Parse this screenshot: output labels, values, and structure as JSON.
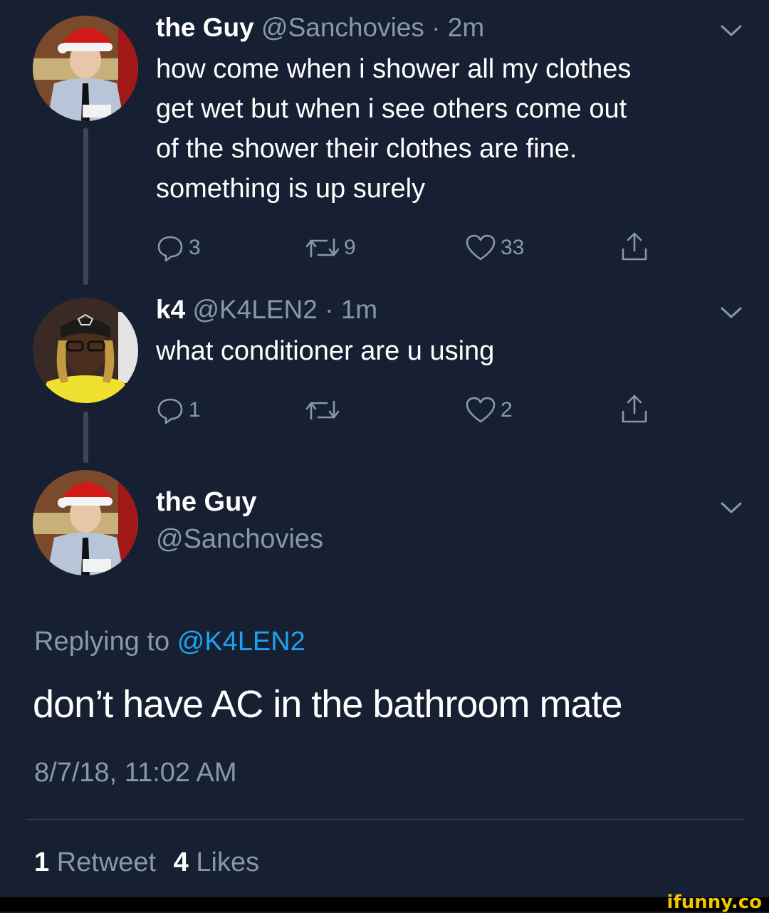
{
  "tweet1": {
    "name": "the Guy",
    "handle": "@Sanchovies",
    "time": "· 2m",
    "text_lines": [
      "how come when i shower all my clothes",
      "get wet but when i see others come out",
      "of the shower their clothes are fine.",
      "something is up surely"
    ],
    "replies": "3",
    "retweets": "9",
    "likes": "33"
  },
  "tweet2": {
    "name": "k4",
    "handle": "@K4LEN2",
    "time": "· 1m",
    "text": "what conditioner are u using",
    "replies": "1",
    "retweets": "",
    "likes": "2"
  },
  "main": {
    "name": "the Guy",
    "handle": "@Sanchovies",
    "replying_prefix": "Replying to",
    "replying_handle": "@K4LEN2",
    "text": "don’t have AC in the bathroom mate",
    "timestamp": "8/7/18, 11:02 AM",
    "retweet_count": "1",
    "retweet_label": "Retweet",
    "like_count": "4",
    "like_label": "Likes"
  },
  "watermark": "ifunny.co",
  "colors": {
    "background": "#162032",
    "muted": "#8899a6",
    "link": "#1da1f2",
    "watermark": "#f2c500"
  },
  "icons": [
    "reply-icon",
    "retweet-icon",
    "like-icon",
    "share-icon",
    "chevron-down-icon"
  ]
}
